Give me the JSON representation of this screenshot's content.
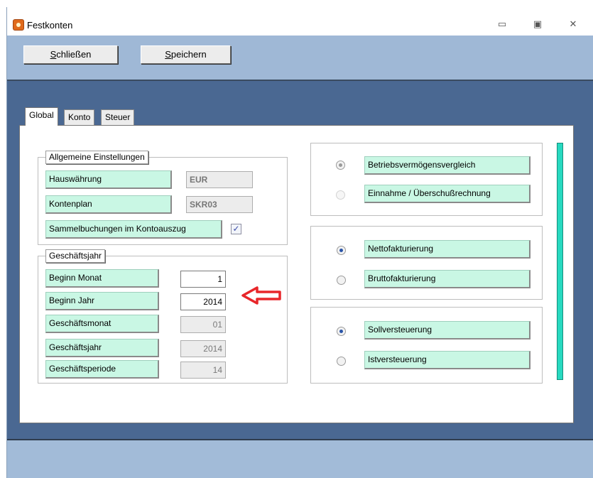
{
  "window": {
    "title": "Festkonten",
    "icon": "app-flame-icon",
    "controls": {
      "minimize": "▭",
      "restore": "▣",
      "close": "✕"
    }
  },
  "toolbar": {
    "close_prefix": "",
    "close_underline": "S",
    "close_rest": "chließen",
    "save_underline": "S",
    "save_rest": "peichern"
  },
  "tabs": [
    {
      "label": "Global",
      "active": true
    },
    {
      "label": "Konto",
      "active": false
    },
    {
      "label": "Steuer",
      "active": false
    }
  ],
  "general": {
    "legend": "Allgemeine Einstellungen",
    "currency_label": "Hauswährung",
    "currency_value": "EUR",
    "chart_label": "Kontenplan",
    "chart_value": "SKR03",
    "collective_label": "Sammelbuchungen im Kontoauszug",
    "collective_checked": "✓"
  },
  "fiscal": {
    "legend": "Geschäftsjahr",
    "start_month_label": "Beginn Monat",
    "start_month_value": "1",
    "start_year_label": "Beginn Jahr",
    "start_year_value": "2014",
    "business_month_label": "Geschäftsmonat",
    "business_month_value": "01",
    "business_year_label": "Geschäftsjahr",
    "business_year_value": "2014",
    "business_period_label": "Geschäftsperiode",
    "business_period_value": "14"
  },
  "method": {
    "option1": "Betriebsvermögensvergleich",
    "option2": "Einnahme / Überschußrechnung"
  },
  "invoicing": {
    "option1": "Nettofakturierung",
    "option2": "Bruttofakturierung"
  },
  "taxation": {
    "option1": "Sollversteuerung",
    "option2": "Istversteuerung"
  },
  "colors": {
    "label_button_bg": "#c9f7e4",
    "accent_bar": "#27d9c0",
    "annotation_arrow": "#e8262a"
  }
}
